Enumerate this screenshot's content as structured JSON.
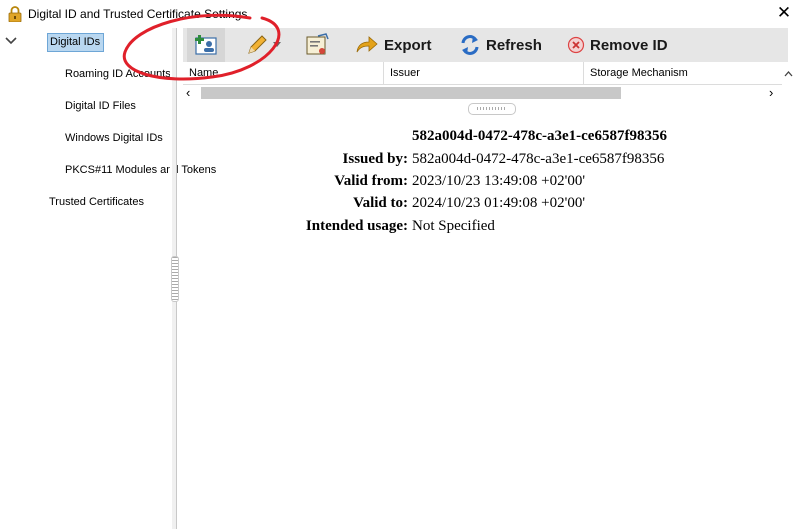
{
  "window": {
    "title": "Digital ID and Trusted Certificate Settings",
    "close_glyph": "✕"
  },
  "sidebar": {
    "items": [
      {
        "label": "Digital IDs"
      },
      {
        "label": "Roaming ID Accounts"
      },
      {
        "label": "Digital ID Files"
      },
      {
        "label": "Windows Digital IDs"
      },
      {
        "label": "PKCS#11 Modules and Tokens"
      },
      {
        "label": "Trusted Certificates"
      }
    ]
  },
  "toolbar": {
    "export_label": "Export",
    "refresh_label": "Refresh",
    "remove_label": "Remove ID"
  },
  "table": {
    "columns": [
      "Name",
      "Issuer",
      "Storage Mechanism"
    ]
  },
  "details": {
    "heading": "582a004d-0472-478c-a3e1-ce6587f98356",
    "issued_by_label": "Issued by:",
    "issued_by": "582a004d-0472-478c-a3e1-ce6587f98356",
    "valid_from_label": "Valid from:",
    "valid_from": "2023/10/23 13:49:08 +02'00'",
    "valid_to_label": "Valid to:",
    "valid_to": "2024/10/23 01:49:08 +02'00'",
    "usage_label": "Intended usage:",
    "usage": "Not Specified"
  },
  "colors": {
    "selection": "#b9d7f0",
    "annotation": "#e0202a",
    "toolbar_bg": "#e6e6e6"
  },
  "icons": [
    "lock-icon",
    "close-icon",
    "chevron-down-icon",
    "add-id-icon",
    "edit-pencil-icon",
    "certificate-icon",
    "export-arrow-icon",
    "refresh-icon",
    "remove-icon"
  ]
}
